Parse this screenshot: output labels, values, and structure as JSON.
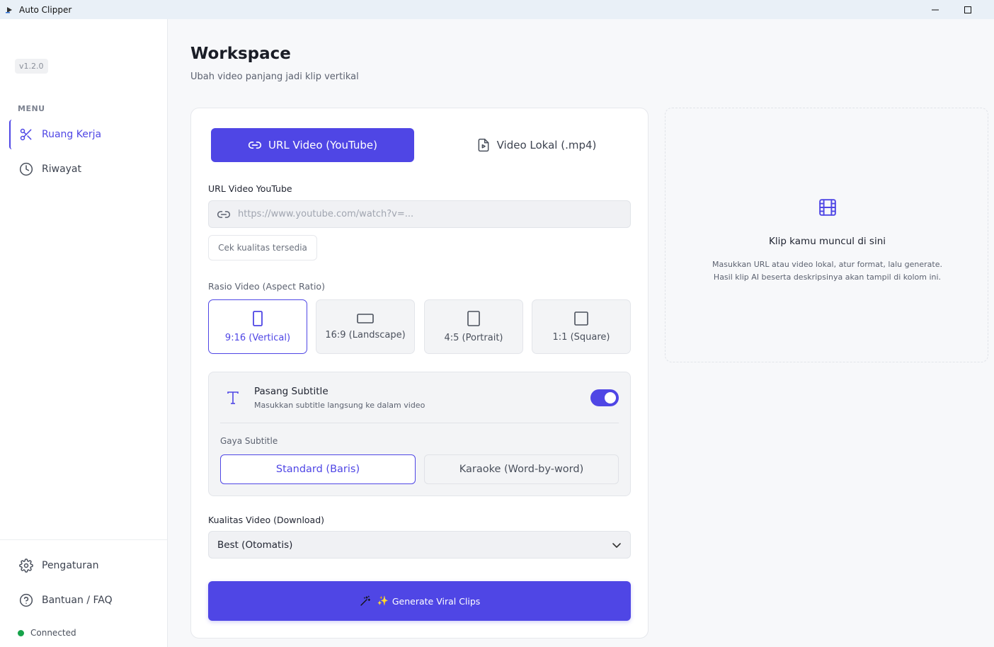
{
  "window": {
    "title": "Auto Clipper"
  },
  "sidebar": {
    "version": "v1.2.0",
    "menu_heading": "MENU",
    "items": [
      {
        "label": "Ruang Kerja",
        "icon": "scissors-icon",
        "active": true
      },
      {
        "label": "Riwayat",
        "icon": "clock-icon",
        "active": false
      }
    ],
    "bottom_items": [
      {
        "label": "Pengaturan",
        "icon": "gear-icon"
      },
      {
        "label": "Bantuan / FAQ",
        "icon": "help-circle-icon"
      }
    ],
    "status": {
      "label": "Connected",
      "color": "#16a34a"
    }
  },
  "main": {
    "title": "Workspace",
    "subtitle": "Ubah video panjang jadi klip vertikal",
    "tabs": [
      {
        "label": "URL Video (YouTube)",
        "icon": "link-icon",
        "active": true
      },
      {
        "label": "Video Lokal (.mp4)",
        "icon": "video-file-icon",
        "active": false
      }
    ],
    "url_label": "URL Video YouTube",
    "url_placeholder": "https://www.youtube.com/watch?v=...",
    "url_value": "",
    "check_quality_label": "Cek kualitas tersedia",
    "ratio_label": "Rasio Video (Aspect Ratio)",
    "ratios": [
      {
        "label": "9:16 (Vertical)",
        "active": true
      },
      {
        "label": "16:9 (Landscape)",
        "active": false
      },
      {
        "label": "4:5 (Portrait)",
        "active": false
      },
      {
        "label": "1:1 (Square)",
        "active": false
      }
    ],
    "subtitle_section": {
      "title": "Pasang Subtitle",
      "description": "Masukkan subtitle langsung ke dalam video",
      "enabled": true,
      "style_label": "Gaya Subtitle",
      "styles": [
        {
          "label": "Standard (Baris)",
          "active": true
        },
        {
          "label": "Karaoke (Word-by-word)",
          "active": false
        }
      ]
    },
    "quality_label": "Kualitas Video (Download)",
    "quality_value": "Best (Otomatis)",
    "generate_label": "Generate Viral Clips",
    "generate_emoji": "✨"
  },
  "preview": {
    "title": "Klip kamu muncul di sini",
    "desc_line1": "Masukkan URL atau video lokal, atur format, lalu generate.",
    "desc_line2": "Hasil klip AI beserta deskripsinya akan tampil di kolom ini."
  },
  "colors": {
    "accent": "#4f46e5",
    "status_green": "#16a34a"
  }
}
